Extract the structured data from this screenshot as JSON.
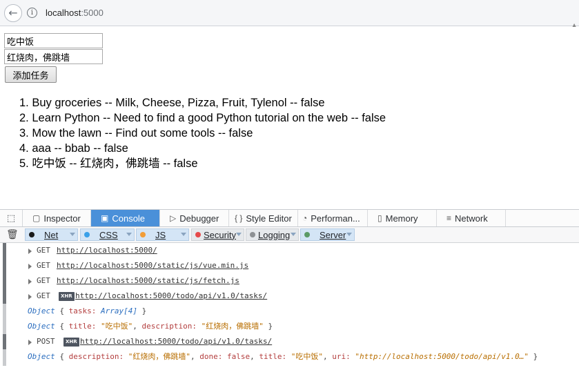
{
  "browser": {
    "url_host": "localhost",
    "url_port": ":5000"
  },
  "form": {
    "title_value": "吃中饭",
    "description_value": "红烧肉，佛跳墙",
    "add_button_label": "添加任务"
  },
  "tasks": [
    "1. Buy groceries -- Milk, Cheese, Pizza, Fruit, Tylenol -- false",
    "2. Learn Python -- Need to find a good Python tutorial on the web -- false",
    "3. Mow the lawn -- Find out some tools -- false",
    "4. aaa -- bbab -- false",
    "5. 吃中饭 -- 红烧肉，佛跳墙 -- false"
  ],
  "devtools": {
    "tabs": [
      {
        "label": "Inspector",
        "icon": "inspector-icon"
      },
      {
        "label": "Console",
        "icon": "console-icon",
        "active": true
      },
      {
        "label": "Debugger",
        "icon": "debugger-icon"
      },
      {
        "label": "Style Editor",
        "icon": "style-editor-icon"
      },
      {
        "label": "Performan...",
        "icon": "performance-icon"
      },
      {
        "label": "Memory",
        "icon": "memory-icon"
      },
      {
        "label": "Network",
        "icon": "network-icon"
      }
    ],
    "filters": [
      {
        "label": "Net",
        "color": "#1a1a1a"
      },
      {
        "label": "CSS",
        "color": "#3aa0e8"
      },
      {
        "label": "JS",
        "color": "#f29d38"
      },
      {
        "label": "Security",
        "color": "#e64a4a"
      },
      {
        "label": "Logging",
        "color": "#8e9194"
      },
      {
        "label": "Server",
        "color": "#5c9a66"
      }
    ]
  },
  "console": {
    "requests": [
      {
        "method": "GET",
        "xhr": false,
        "url": "http://localhost:5000/"
      },
      {
        "method": "GET",
        "xhr": false,
        "url": "http://localhost:5000/static/js/vue.min.js"
      },
      {
        "method": "GET",
        "xhr": false,
        "url": "http://localhost:5000/static/js/fetch.js"
      },
      {
        "method": "GET",
        "xhr": true,
        "url": "http://localhost:5000/todo/api/v1.0/tasks/"
      },
      {
        "method": "POST",
        "xhr": true,
        "url": "http://localhost:5000/todo/api/v1.0/tasks/"
      }
    ],
    "xhr_badge": "XHR",
    "obj1": {
      "obj": "Object",
      "open": "{",
      "key": "tasks:",
      "val": "Array[4]",
      "close": "}"
    },
    "obj2": {
      "obj": "Object",
      "open": "{",
      "k1": "title:",
      "v1": "\"吃中饭\"",
      "sep1": ",",
      "k2": "description:",
      "v2": "\"红烧肉，佛跳墙\"",
      "close": "}"
    },
    "obj3": {
      "obj": "Object",
      "open": "{",
      "k1": "description:",
      "v1": "\"红烧肉，佛跳墙\"",
      "sep1": ",",
      "k2": "done:",
      "v2": "false",
      "sep2": ",",
      "k3": "title:",
      "v3": "\"吃中饭\"",
      "sep3": ",",
      "k4": "uri:",
      "v4": "\"http://localhost:5000/todo/api/v1.0…\"",
      "close": "}"
    }
  },
  "colors": {
    "active_tab": "#4a90d9",
    "filter_bg": "#d4e5f6"
  }
}
